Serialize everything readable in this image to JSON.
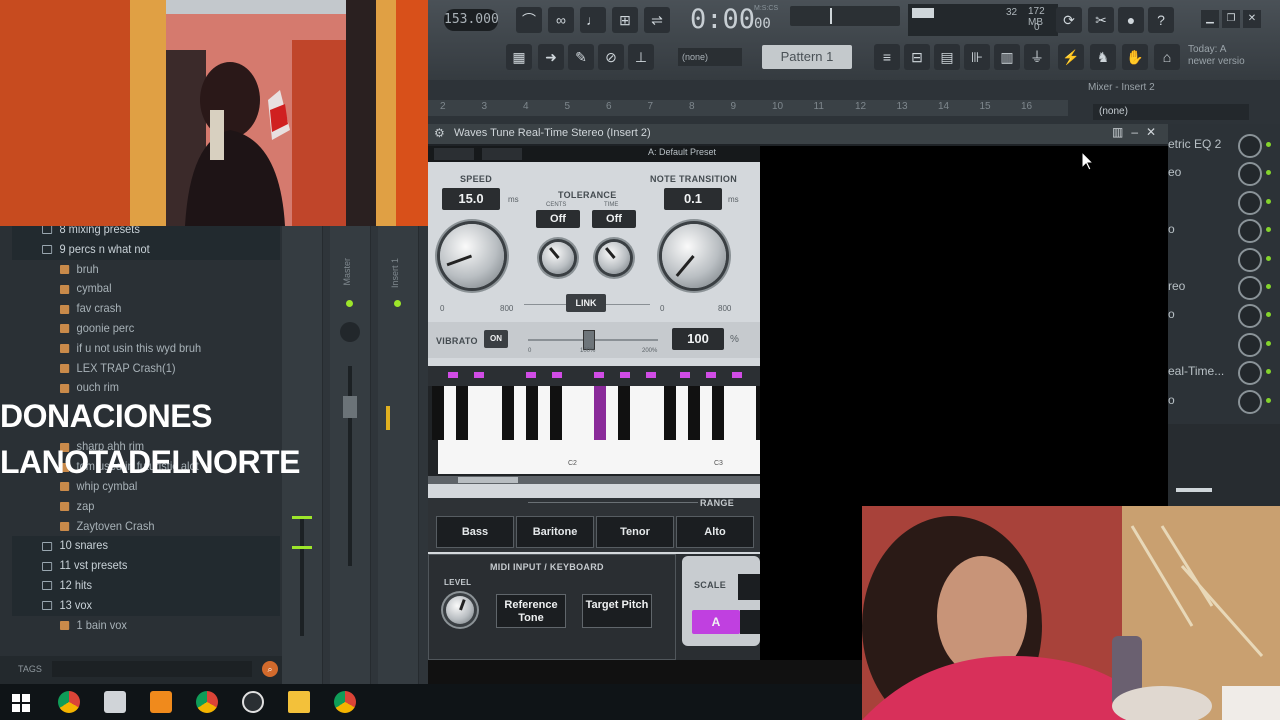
{
  "toolbar": {
    "tempo": "153.000",
    "time": "0:00",
    "time_sub": "00",
    "time_unit": "M:S:CS",
    "cpu_value": "32",
    "ram_value": "172 MB",
    "poly_value": "0",
    "pattern": "Pattern 1",
    "channel_select": "(none)",
    "hint_line1": "Today: A",
    "hint_line2": "newer versio"
  },
  "playlist": {
    "ruler_numbers": [
      "2",
      "3",
      "4",
      "5",
      "6",
      "7",
      "8",
      "9",
      "10",
      "11",
      "12",
      "13",
      "14",
      "15",
      "16"
    ],
    "mixer_header": "Mixer - Insert 2",
    "mixer_select": "(none)"
  },
  "browser": {
    "items": [
      {
        "label": "8 mixing presets",
        "type": "folder"
      },
      {
        "label": "9 percs n what not",
        "type": "folder"
      },
      {
        "label": "bruh",
        "type": "file"
      },
      {
        "label": "cymbal",
        "type": "file"
      },
      {
        "label": "fav crash",
        "type": "file"
      },
      {
        "label": "goonie perc",
        "type": "file"
      },
      {
        "label": "if u not usin this wyd bruh",
        "type": "file"
      },
      {
        "label": "LEX TRAP Crash(1)",
        "type": "file"
      },
      {
        "label": "ouch rim",
        "type": "file"
      },
      {
        "label": "sharp ahh rim",
        "type": "file"
      },
      {
        "label": "tom used in futuristic alot",
        "type": "file"
      },
      {
        "label": "whip cymbal",
        "type": "file"
      },
      {
        "label": "zap",
        "type": "file"
      },
      {
        "label": "Zaytoven Crash",
        "type": "file"
      },
      {
        "label": "10 snares",
        "type": "folder"
      },
      {
        "label": "11 vst presets",
        "type": "folder"
      },
      {
        "label": "12 hits",
        "type": "folder"
      },
      {
        "label": "13 vox",
        "type": "folder"
      },
      {
        "label": "1 bain vox",
        "type": "file"
      }
    ],
    "tags_label": "TAGS"
  },
  "mixer_strip": {
    "master_label": "Master",
    "insert_label": "Insert 1"
  },
  "overlay": {
    "line1": "DONACIONES",
    "line2": "LANOTADELNORTE"
  },
  "plugin": {
    "title": "Waves Tune Real-Time Stereo (Insert 2)",
    "preset": "A: Default Preset",
    "speed_label": "SPEED",
    "speed_value": "15.0",
    "speed_unit": "ms",
    "speed_min": "0",
    "speed_max": "800",
    "tolerance_label": "TOLERANCE",
    "cents_label": "CENTS",
    "time_label": "TIME",
    "cents_value": "Off",
    "time_value": "Off",
    "link_label": "LINK",
    "note_transition_label": "NOTE TRANSITION",
    "note_transition_value": "0.1",
    "note_transition_unit": "ms",
    "nt_min": "0",
    "nt_max": "800",
    "vibrato_label": "VIBRATO",
    "vibrato_toggle": "ON",
    "vibrato_value": "100",
    "vibrato_unit": "%",
    "vibrato_min": "0",
    "vibrato_mid": "100%",
    "vibrato_max": "200%",
    "kb_label_c2": "C2",
    "kb_label_c3": "C3",
    "range_label": "RANGE",
    "range_buttons": [
      "Bass",
      "Baritone",
      "Tenor",
      "Alto"
    ],
    "midi_label": "MIDI INPUT / KEYBOARD",
    "level_label": "LEVEL",
    "reference_tone": "Reference Tone",
    "target_pitch": "Target Pitch",
    "scale_label": "SCALE",
    "key_value": "A"
  },
  "right_mixer": {
    "slots": [
      "etric EQ 2",
      "eo",
      "",
      "o",
      "",
      "reo",
      "o",
      "",
      "eal-Time...",
      "o"
    ]
  },
  "colors": {
    "accent_purple": "#d14ce6",
    "led_green": "#9de62a",
    "brand_orange": "#d26a2c"
  }
}
